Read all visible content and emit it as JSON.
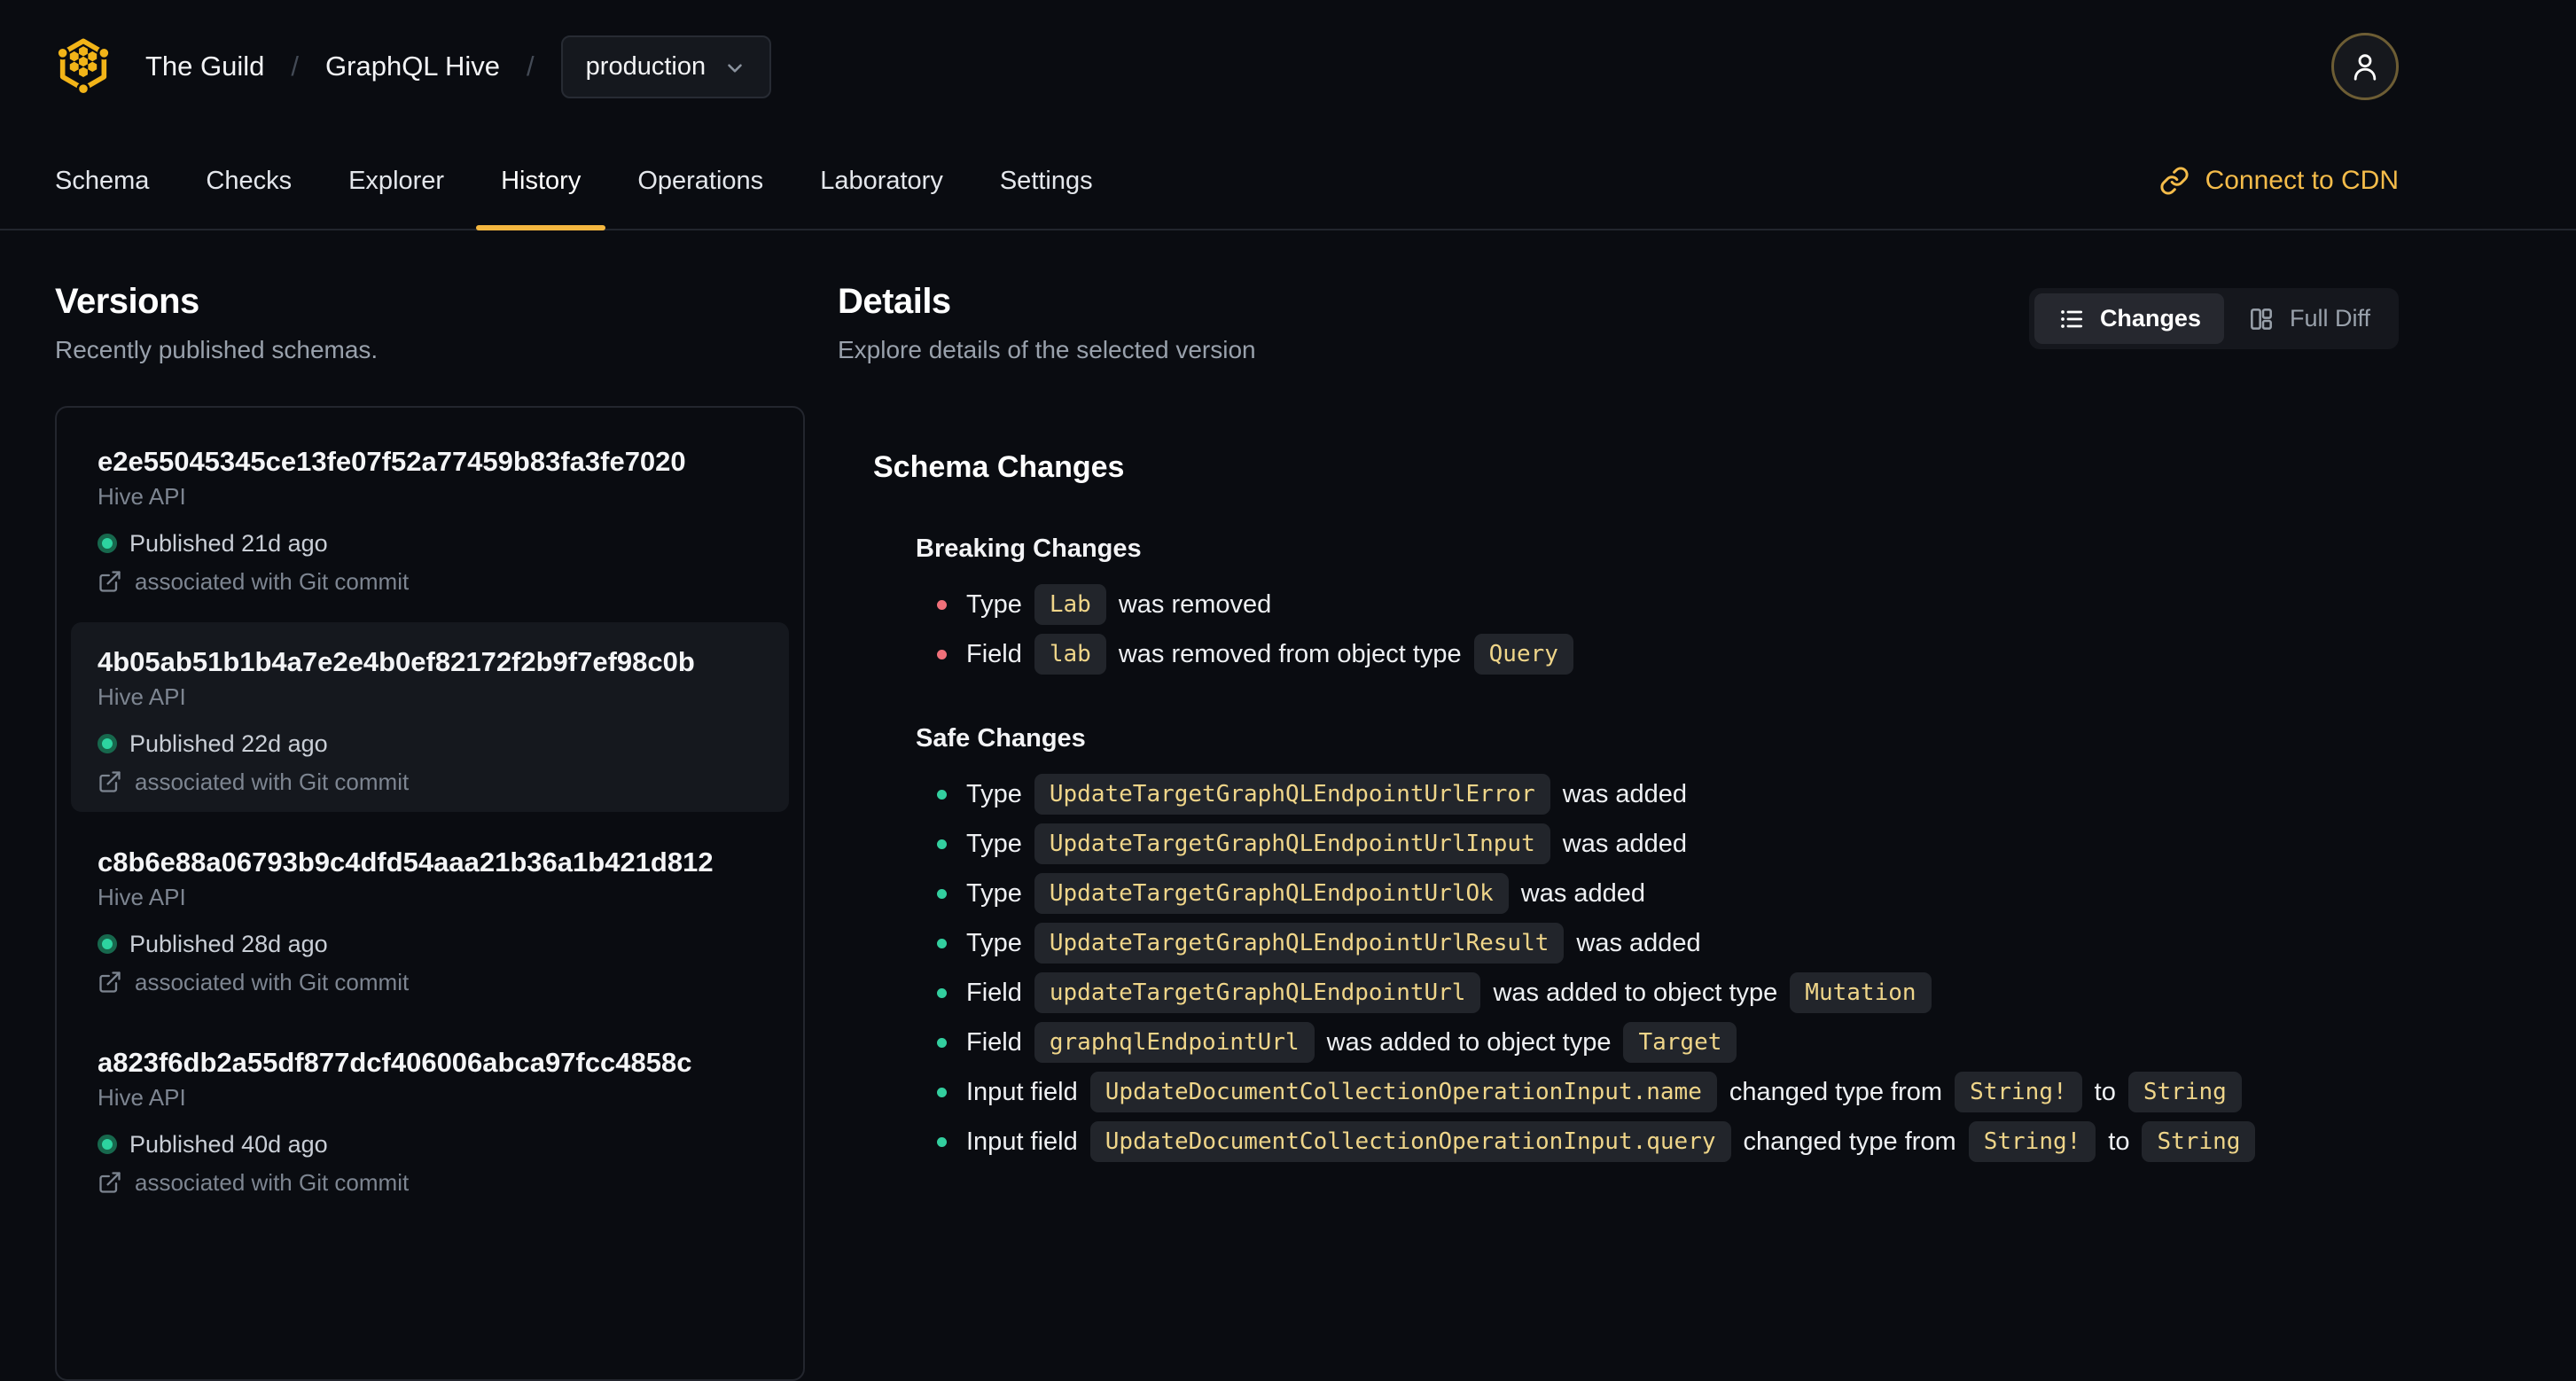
{
  "header": {
    "breadcrumb": {
      "organization": "The Guild",
      "separator": "/",
      "project": "GraphQL Hive",
      "target": "production"
    },
    "tabs": [
      {
        "label": "Schema",
        "active": false
      },
      {
        "label": "Checks",
        "active": false
      },
      {
        "label": "Explorer",
        "active": false
      },
      {
        "label": "History",
        "active": true
      },
      {
        "label": "Operations",
        "active": false
      },
      {
        "label": "Laboratory",
        "active": false
      },
      {
        "label": "Settings",
        "active": false
      }
    ],
    "connect_cdn_label": "Connect to CDN",
    "icons": {
      "logo": "hive-hexagon-logo",
      "target_dropdown": "chevron-down-icon",
      "user_menu": "user-icon",
      "connect_cdn": "link-icon"
    }
  },
  "versions": {
    "title": "Versions",
    "subtitle": "Recently published schemas.",
    "items": [
      {
        "hash": "e2e55045345ce13fe07f52a77459b83fa3fe7020",
        "service": "Hive API",
        "status": "Published 21d ago",
        "git_link": "associated with Git commit",
        "selected": false
      },
      {
        "hash": "4b05ab51b1b4a7e2e4b0ef82172f2b9f7ef98c0b",
        "service": "Hive API",
        "status": "Published 22d ago",
        "git_link": "associated with Git commit",
        "selected": true
      },
      {
        "hash": "c8b6e88a06793b9c4dfd54aaa21b36a1b421d812",
        "service": "Hive API",
        "status": "Published 28d ago",
        "git_link": "associated with Git commit",
        "selected": false
      },
      {
        "hash": "a823f6db2a55df877dcf406006abca97fcc4858c",
        "service": "Hive API",
        "status": "Published 40d ago",
        "git_link": "associated with Git commit",
        "selected": false
      }
    ]
  },
  "details": {
    "title": "Details",
    "subtitle": "Explore details of the selected version",
    "view_toggle": {
      "changes_label": "Changes",
      "full_diff_label": "Full Diff",
      "active": "changes",
      "icons": {
        "changes": "list-icon",
        "full_diff": "columns-icon"
      }
    },
    "schema_changes": {
      "title": "Schema Changes",
      "sections": [
        {
          "name": "Breaking Changes",
          "severity": "breaking",
          "items": [
            [
              {
                "type": "text",
                "value": "Type"
              },
              {
                "type": "code",
                "value": "Lab"
              },
              {
                "type": "text",
                "value": "was removed"
              }
            ],
            [
              {
                "type": "text",
                "value": "Field"
              },
              {
                "type": "code",
                "value": "lab"
              },
              {
                "type": "text",
                "value": "was removed from object type"
              },
              {
                "type": "code",
                "value": "Query"
              }
            ]
          ]
        },
        {
          "name": "Safe Changes",
          "severity": "safe",
          "items": [
            [
              {
                "type": "text",
                "value": "Type"
              },
              {
                "type": "code",
                "value": "UpdateTargetGraphQLEndpointUrlError"
              },
              {
                "type": "text",
                "value": "was added"
              }
            ],
            [
              {
                "type": "text",
                "value": "Type"
              },
              {
                "type": "code",
                "value": "UpdateTargetGraphQLEndpointUrlInput"
              },
              {
                "type": "text",
                "value": "was added"
              }
            ],
            [
              {
                "type": "text",
                "value": "Type"
              },
              {
                "type": "code",
                "value": "UpdateTargetGraphQLEndpointUrlOk"
              },
              {
                "type": "text",
                "value": "was added"
              }
            ],
            [
              {
                "type": "text",
                "value": "Type"
              },
              {
                "type": "code",
                "value": "UpdateTargetGraphQLEndpointUrlResult"
              },
              {
                "type": "text",
                "value": "was added"
              }
            ],
            [
              {
                "type": "text",
                "value": "Field"
              },
              {
                "type": "code",
                "value": "updateTargetGraphQLEndpointUrl"
              },
              {
                "type": "text",
                "value": "was added to object type"
              },
              {
                "type": "code",
                "value": "Mutation"
              }
            ],
            [
              {
                "type": "text",
                "value": "Field"
              },
              {
                "type": "code",
                "value": "graphqlEndpointUrl"
              },
              {
                "type": "text",
                "value": "was added to object type"
              },
              {
                "type": "code",
                "value": "Target"
              }
            ],
            [
              {
                "type": "text",
                "value": "Input field"
              },
              {
                "type": "code",
                "value": "UpdateDocumentCollectionOperationInput.name"
              },
              {
                "type": "text",
                "value": "changed type from"
              },
              {
                "type": "code",
                "value": "String!"
              },
              {
                "type": "text",
                "value": "to"
              },
              {
                "type": "code",
                "value": "String"
              }
            ],
            [
              {
                "type": "text",
                "value": "Input field"
              },
              {
                "type": "code",
                "value": "UpdateDocumentCollectionOperationInput.query"
              },
              {
                "type": "text",
                "value": "changed type from"
              },
              {
                "type": "code",
                "value": "String!"
              },
              {
                "type": "text",
                "value": "to"
              },
              {
                "type": "code",
                "value": "String"
              }
            ]
          ]
        }
      ]
    }
  },
  "colors": {
    "background": "#0a0c11",
    "accent_yellow": "#f4b740",
    "breaking_bullet": "#f0707a",
    "safe_bullet": "#33cf9f",
    "published_dot": "#2dd4a0",
    "code_text": "#efd589",
    "code_background": "#22252b"
  }
}
